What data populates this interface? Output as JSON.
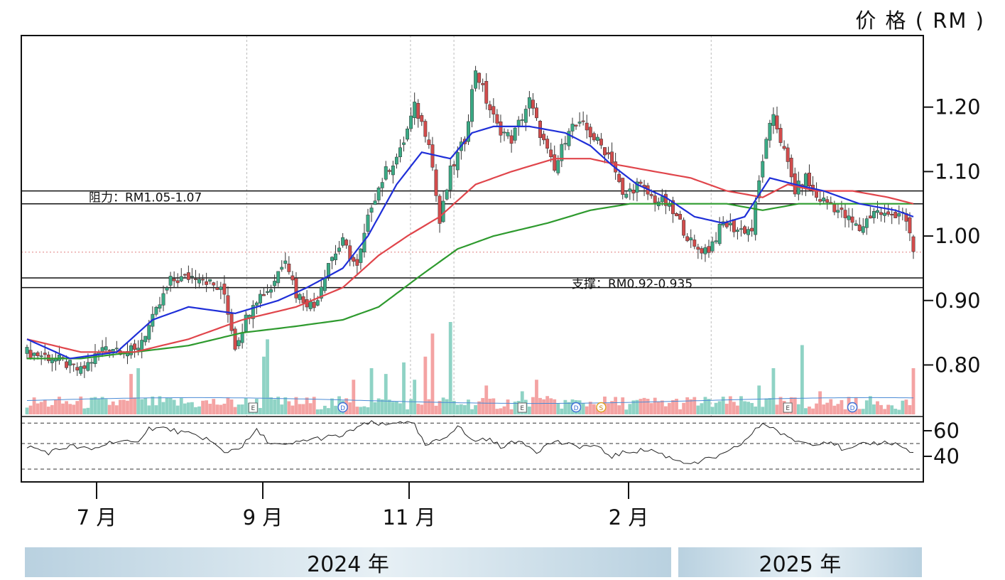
{
  "unit_label": "价 格 ( RM )",
  "years": [
    "2024 年",
    "2025 年"
  ],
  "colors": {
    "candle_up": "#3aaa85",
    "candle_down": "#d24c4c",
    "ma_short": "#1f2fd8",
    "ma_mid": "#e0454b",
    "ma_long": "#2e9a2e",
    "vol_up": "#8fd3c5",
    "vol_down": "#f4a3a3",
    "vol_avg": "#4b8bd6",
    "rsi": "#222222"
  },
  "chart_data": {
    "type": "candlestick",
    "y_ticks": [
      "1.20",
      "1.10",
      "1.00",
      "0.90",
      "0.80"
    ],
    "y_tick_values": [
      1.2,
      1.1,
      1.0,
      0.9,
      0.8
    ],
    "price_range": [
      0.72,
      1.3
    ],
    "x_labels": [
      "7 月",
      "9 月",
      "11 月",
      "2 月"
    ],
    "x_label_days": [
      15,
      76,
      125,
      215
    ],
    "total_days": 270,
    "resistance": {
      "label": "阻力：RM1.05-1.07",
      "low": 1.05,
      "high": 1.07
    },
    "support": {
      "label": "支撑：RM0.92-0.935",
      "low": 0.92,
      "high": 0.935
    },
    "last_price_line": 0.975,
    "close_anchors": [
      [
        0,
        0.82
      ],
      [
        8,
        0.81
      ],
      [
        15,
        0.79
      ],
      [
        22,
        0.83
      ],
      [
        30,
        0.82
      ],
      [
        35,
        0.87
      ],
      [
        40,
        0.93
      ],
      [
        48,
        0.94
      ],
      [
        55,
        0.91
      ],
      [
        58,
        0.83
      ],
      [
        63,
        0.9
      ],
      [
        68,
        0.92
      ],
      [
        72,
        0.97
      ],
      [
        75,
        0.91
      ],
      [
        80,
        0.89
      ],
      [
        84,
        0.96
      ],
      [
        88,
        0.99
      ],
      [
        92,
        0.95
      ],
      [
        96,
        1.05
      ],
      [
        100,
        1.1
      ],
      [
        104,
        1.13
      ],
      [
        108,
        1.2
      ],
      [
        112,
        1.15
      ],
      [
        115,
        1.02
      ],
      [
        118,
        1.1
      ],
      [
        122,
        1.15
      ],
      [
        125,
        1.26
      ],
      [
        128,
        1.21
      ],
      [
        131,
        1.17
      ],
      [
        135,
        1.15
      ],
      [
        140,
        1.21
      ],
      [
        143,
        1.16
      ],
      [
        147,
        1.1
      ],
      [
        151,
        1.17
      ],
      [
        155,
        1.17
      ],
      [
        160,
        1.14
      ],
      [
        163,
        1.12
      ],
      [
        166,
        1.06
      ],
      [
        170,
        1.08
      ],
      [
        174,
        1.06
      ],
      [
        178,
        1.05
      ],
      [
        182,
        1.02
      ],
      [
        186,
        0.98
      ],
      [
        190,
        0.98
      ],
      [
        194,
        1.02
      ],
      [
        198,
        1.01
      ],
      [
        202,
        1.01
      ],
      [
        205,
        1.12
      ],
      [
        208,
        1.19
      ],
      [
        211,
        1.13
      ],
      [
        214,
        1.07
      ],
      [
        217,
        1.09
      ],
      [
        220,
        1.06
      ],
      [
        224,
        1.05
      ],
      [
        228,
        1.03
      ],
      [
        232,
        1.01
      ],
      [
        236,
        1.04
      ],
      [
        240,
        1.03
      ],
      [
        244,
        1.04
      ],
      [
        247,
        0.975
      ]
    ],
    "ma_short_anchors": [
      [
        0,
        0.84
      ],
      [
        12,
        0.81
      ],
      [
        25,
        0.82
      ],
      [
        35,
        0.87
      ],
      [
        45,
        0.89
      ],
      [
        58,
        0.88
      ],
      [
        70,
        0.9
      ],
      [
        78,
        0.92
      ],
      [
        88,
        0.95
      ],
      [
        95,
        1.0
      ],
      [
        103,
        1.08
      ],
      [
        110,
        1.13
      ],
      [
        118,
        1.12
      ],
      [
        124,
        1.16
      ],
      [
        130,
        1.17
      ],
      [
        140,
        1.17
      ],
      [
        150,
        1.16
      ],
      [
        157,
        1.14
      ],
      [
        163,
        1.11
      ],
      [
        170,
        1.08
      ],
      [
        178,
        1.06
      ],
      [
        186,
        1.03
      ],
      [
        194,
        1.02
      ],
      [
        200,
        1.03
      ],
      [
        207,
        1.09
      ],
      [
        214,
        1.08
      ],
      [
        222,
        1.07
      ],
      [
        232,
        1.05
      ],
      [
        242,
        1.04
      ],
      [
        247,
        1.03
      ]
    ],
    "ma_mid_anchors": [
      [
        0,
        0.84
      ],
      [
        15,
        0.82
      ],
      [
        30,
        0.82
      ],
      [
        45,
        0.84
      ],
      [
        60,
        0.87
      ],
      [
        75,
        0.89
      ],
      [
        88,
        0.92
      ],
      [
        98,
        0.97
      ],
      [
        106,
        1.0
      ],
      [
        115,
        1.03
      ],
      [
        125,
        1.08
      ],
      [
        135,
        1.1
      ],
      [
        147,
        1.12
      ],
      [
        157,
        1.12
      ],
      [
        165,
        1.11
      ],
      [
        175,
        1.1
      ],
      [
        185,
        1.09
      ],
      [
        195,
        1.07
      ],
      [
        205,
        1.06
      ],
      [
        212,
        1.08
      ],
      [
        220,
        1.07
      ],
      [
        230,
        1.07
      ],
      [
        240,
        1.06
      ],
      [
        247,
        1.05
      ]
    ],
    "ma_long_anchors": [
      [
        0,
        0.81
      ],
      [
        15,
        0.81
      ],
      [
        30,
        0.82
      ],
      [
        45,
        0.83
      ],
      [
        60,
        0.85
      ],
      [
        75,
        0.86
      ],
      [
        88,
        0.87
      ],
      [
        98,
        0.89
      ],
      [
        110,
        0.94
      ],
      [
        120,
        0.98
      ],
      [
        130,
        1.0
      ],
      [
        145,
        1.02
      ],
      [
        157,
        1.04
      ],
      [
        168,
        1.05
      ],
      [
        180,
        1.05
      ],
      [
        195,
        1.05
      ],
      [
        205,
        1.04
      ],
      [
        215,
        1.05
      ],
      [
        230,
        1.05
      ],
      [
        247,
        1.05
      ]
    ],
    "volume_max_millions": 16,
    "volume_spikes": [
      [
        29,
        7
      ],
      [
        31,
        8
      ],
      [
        66,
        10
      ],
      [
        67,
        13
      ],
      [
        91,
        6
      ],
      [
        96,
        8
      ],
      [
        100,
        7
      ],
      [
        105,
        9
      ],
      [
        108,
        6
      ],
      [
        111,
        10
      ],
      [
        113,
        14
      ],
      [
        118,
        16
      ],
      [
        128,
        5
      ],
      [
        138,
        4
      ],
      [
        142,
        6
      ],
      [
        186,
        3
      ],
      [
        204,
        5
      ],
      [
        208,
        8
      ],
      [
        216,
        12
      ],
      [
        221,
        4
      ],
      [
        247,
        8
      ]
    ],
    "event_markers": [
      "E",
      "D",
      "E",
      "D",
      "S",
      "E",
      "D"
    ],
    "event_marker_days": [
      63,
      88,
      138,
      153,
      160,
      212,
      230
    ],
    "rsi_ticks": [
      "60",
      "40"
    ],
    "rsi_tick_values": [
      60,
      40
    ],
    "rsi_range": [
      20,
      70
    ],
    "rsi_levels": [
      66,
      50,
      30
    ],
    "rsi_anchors": [
      [
        0,
        48
      ],
      [
        6,
        43
      ],
      [
        12,
        48
      ],
      [
        18,
        45
      ],
      [
        24,
        52
      ],
      [
        30,
        50
      ],
      [
        34,
        62
      ],
      [
        38,
        62
      ],
      [
        44,
        58
      ],
      [
        50,
        54
      ],
      [
        55,
        43
      ],
      [
        60,
        48
      ],
      [
        64,
        60
      ],
      [
        68,
        50
      ],
      [
        72,
        48
      ],
      [
        78,
        53
      ],
      [
        84,
        55
      ],
      [
        88,
        56
      ],
      [
        92,
        63
      ],
      [
        96,
        66
      ],
      [
        100,
        64
      ],
      [
        104,
        68
      ],
      [
        108,
        64
      ],
      [
        111,
        48
      ],
      [
        116,
        54
      ],
      [
        120,
        64
      ],
      [
        124,
        52
      ],
      [
        128,
        54
      ],
      [
        132,
        48
      ],
      [
        138,
        52
      ],
      [
        142,
        44
      ],
      [
        147,
        52
      ],
      [
        152,
        48
      ],
      [
        158,
        48
      ],
      [
        163,
        40
      ],
      [
        168,
        44
      ],
      [
        174,
        45
      ],
      [
        180,
        38
      ],
      [
        186,
        34
      ],
      [
        190,
        38
      ],
      [
        195,
        42
      ],
      [
        200,
        52
      ],
      [
        205,
        66
      ],
      [
        208,
        62
      ],
      [
        212,
        54
      ],
      [
        218,
        50
      ],
      [
        224,
        52
      ],
      [
        228,
        44
      ],
      [
        234,
        50
      ],
      [
        240,
        51
      ],
      [
        243,
        49
      ],
      [
        247,
        42
      ]
    ]
  }
}
